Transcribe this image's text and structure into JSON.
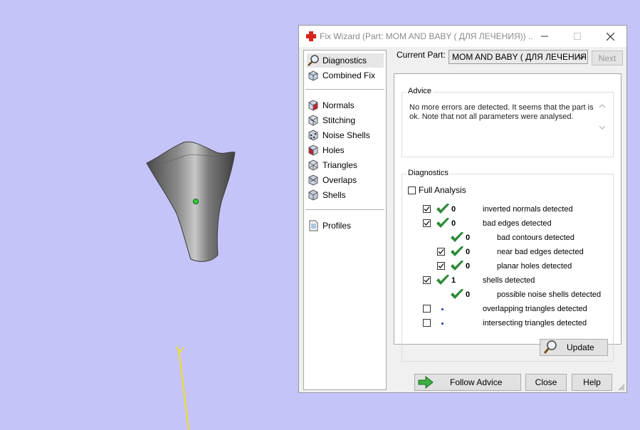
{
  "dialog": {
    "title": "Fix Wizard (Part: MOM AND BABY ( ДЛЯ ЛЕЧЕНИЯ)) ...",
    "window_controls": {
      "minimize": "–",
      "maximize": "☐",
      "close": "✕"
    }
  },
  "nav": {
    "group1": [
      {
        "label": "Diagnostics",
        "icon": "magnifier-icon",
        "selected": true
      },
      {
        "label": "Combined Fix",
        "icon": "combined-fix-icon",
        "selected": false
      }
    ],
    "group2": [
      {
        "label": "Normals",
        "icon": "normals-cube-icon"
      },
      {
        "label": "Stitching",
        "icon": "stitching-cube-icon"
      },
      {
        "label": "Noise Shells",
        "icon": "noise-shells-icon"
      },
      {
        "label": "Holes",
        "icon": "holes-cube-icon"
      },
      {
        "label": "Triangles",
        "icon": "triangles-cube-icon"
      },
      {
        "label": "Overlaps",
        "icon": "overlaps-cube-icon"
      },
      {
        "label": "Shells",
        "icon": "shells-cube-icon"
      }
    ],
    "group3": [
      {
        "label": "Profiles",
        "icon": "document-icon"
      }
    ]
  },
  "header": {
    "current_part_label": "Current Part:",
    "current_part_value": "MOM AND BABY ( ДЛЯ ЛЕЧЕНИЯ",
    "next_label": "Next"
  },
  "advice": {
    "title": "Advice",
    "text": "No more errors are detected. It seems that the part is ok. Note that not all parameters were analysed."
  },
  "diagnostics": {
    "title": "Diagnostics",
    "full_analysis_label": "Full Analysis",
    "full_analysis_checked": false,
    "rows": [
      {
        "checkbox": true,
        "checked": true,
        "status": "check",
        "count": "0",
        "label": "inverted normals detected",
        "indent": 0
      },
      {
        "checkbox": true,
        "checked": true,
        "status": "check",
        "count": "0",
        "label": "bad edges detected",
        "indent": 0
      },
      {
        "checkbox": false,
        "checked": false,
        "status": "check",
        "count": "0",
        "label": "bad contours detected",
        "indent": 1
      },
      {
        "checkbox": true,
        "checked": true,
        "status": "check",
        "count": "0",
        "label": "near bad edges detected",
        "indent": 1
      },
      {
        "checkbox": true,
        "checked": true,
        "status": "check",
        "count": "0",
        "label": "planar holes detected",
        "indent": 1
      },
      {
        "checkbox": true,
        "checked": true,
        "status": "check",
        "count": "1",
        "label": "shells detected",
        "indent": 0
      },
      {
        "checkbox": false,
        "checked": false,
        "status": "check",
        "count": "0",
        "label": "possible noise shells detected",
        "indent": 1
      },
      {
        "checkbox": true,
        "checked": false,
        "status": "dot",
        "count": "",
        "label": "overlapping triangles detected",
        "indent": 0
      },
      {
        "checkbox": true,
        "checked": false,
        "status": "dot",
        "count": "",
        "label": "intersecting triangles detected",
        "indent": 0
      }
    ],
    "update_label": "Update"
  },
  "buttons": {
    "follow_advice": "Follow Advice",
    "close": "Close",
    "help": "Help"
  },
  "colors": {
    "viewport_bg": "#c4c4f8",
    "check_green": "#2e8b3a",
    "model_gray": "#7a7a7a",
    "axis_yellow": "#f0e020"
  }
}
